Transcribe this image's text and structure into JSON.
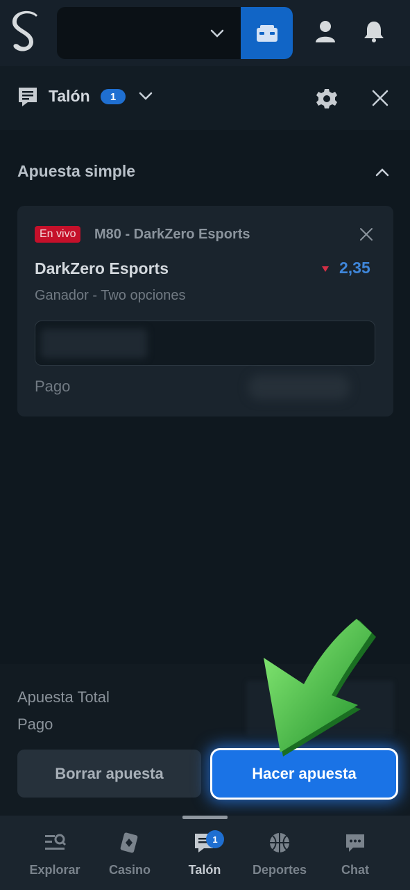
{
  "header": {
    "logo_icon": "s-logo-icon",
    "wallet_icon": "wallet-icon",
    "profile_icon": "user-icon",
    "notifications_icon": "bell-icon"
  },
  "slip": {
    "title": "Talón",
    "count": "1",
    "settings_icon": "gear-icon",
    "close_icon": "close-icon"
  },
  "section": {
    "title": "Apuesta simple"
  },
  "bet": {
    "live_label": "En vivo",
    "event": "M80 - DarkZero Esports",
    "selection": "DarkZero Esports",
    "odds": "2,35",
    "odds_direction": "down",
    "market": "Ganador - Two opciones",
    "payout_label": "Pago"
  },
  "totals": {
    "total_stake_label": "Apuesta Total",
    "payout_label": "Pago"
  },
  "actions": {
    "clear_label": "Borrar apuesta",
    "place_label": "Hacer apuesta"
  },
  "nav": {
    "items": [
      {
        "label": "Explorar",
        "icon": "explore-icon"
      },
      {
        "label": "Casino",
        "icon": "cards-icon"
      },
      {
        "label": "Talón",
        "icon": "betslip-icon",
        "badge": "1",
        "active": true
      },
      {
        "label": "Deportes",
        "icon": "basketball-icon"
      },
      {
        "label": "Chat",
        "icon": "chat-icon"
      }
    ]
  },
  "colors": {
    "accent": "#1a73e6",
    "live": "#c5102a",
    "odds": "#3f86d9",
    "background": "#0f181f"
  }
}
